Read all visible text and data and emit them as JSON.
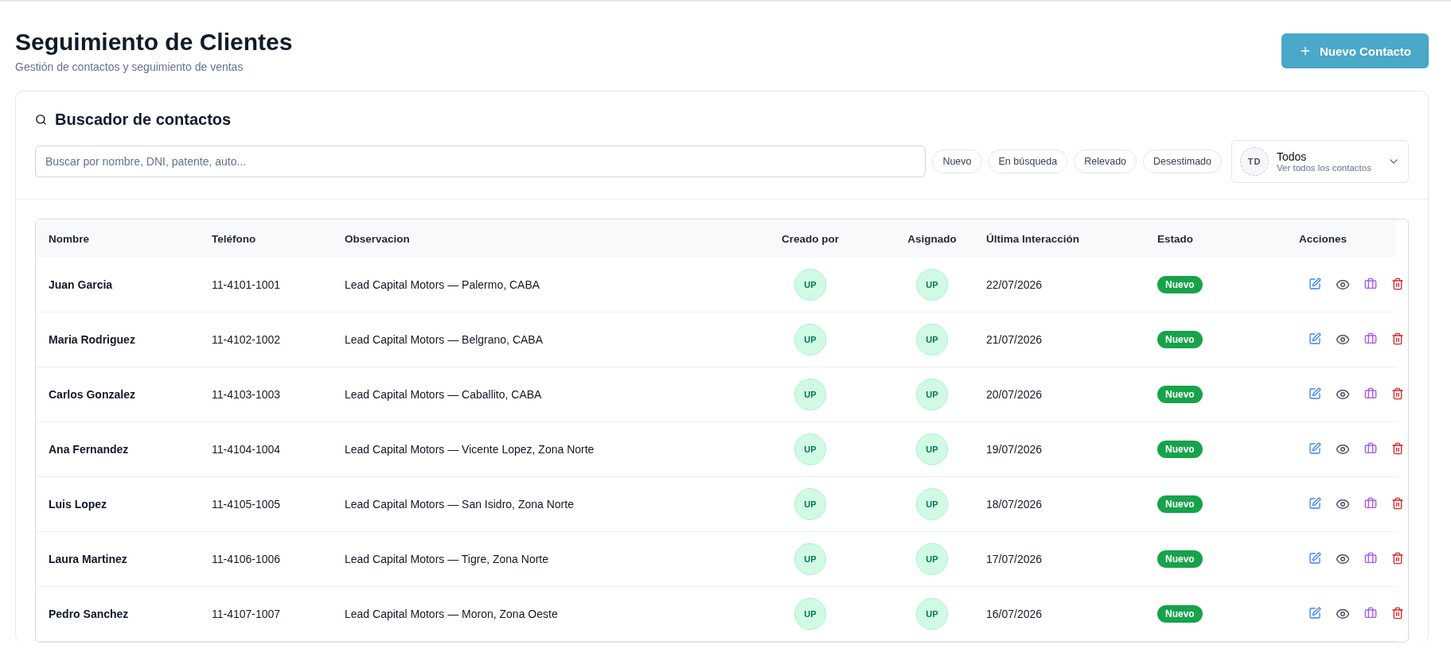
{
  "header": {
    "title": "Seguimiento de Clientes",
    "subtitle": "Gestión de contactos y seguimiento de ventas",
    "new_button": "Nuevo Contacto"
  },
  "search_panel": {
    "title": "Buscador de contactos",
    "search": {
      "placeholder": "Buscar por nombre, DNI, patente, auto..."
    },
    "filters": [
      {
        "label": "Nuevo",
        "selected": false
      },
      {
        "label": "En búsqueda",
        "selected": false
      },
      {
        "label": "Relevado",
        "selected": false
      },
      {
        "label": "Desestimado",
        "selected": false
      }
    ],
    "user_select": {
      "initials": "TD",
      "title": "Todos",
      "subtitle": "Ver todos los contactos"
    }
  },
  "table": {
    "columns": [
      "Nombre",
      "Teléfono",
      "Observacion",
      "Creado por",
      "Asignado",
      "Última Interacción",
      "Estado",
      "Acciones"
    ],
    "rows": [
      {
        "name": "Juan Garcia",
        "phone": "11-4101-1001",
        "note": "Lead Capital Motors — Palermo, CABA",
        "created_by": "UP",
        "assigned": "UP",
        "last": "22/07/2026",
        "status": "Nuevo"
      },
      {
        "name": "Maria Rodriguez",
        "phone": "11-4102-1002",
        "note": "Lead Capital Motors — Belgrano, CABA",
        "created_by": "UP",
        "assigned": "UP",
        "last": "21/07/2026",
        "status": "Nuevo"
      },
      {
        "name": "Carlos Gonzalez",
        "phone": "11-4103-1003",
        "note": "Lead Capital Motors — Caballito, CABA",
        "created_by": "UP",
        "assigned": "UP",
        "last": "20/07/2026",
        "status": "Nuevo"
      },
      {
        "name": "Ana Fernandez",
        "phone": "11-4104-1004",
        "note": "Lead Capital Motors — Vicente Lopez, Zona Norte",
        "created_by": "UP",
        "assigned": "UP",
        "last": "19/07/2026",
        "status": "Nuevo"
      },
      {
        "name": "Luis Lopez",
        "phone": "11-4105-1005",
        "note": "Lead Capital Motors — San Isidro, Zona Norte",
        "created_by": "UP",
        "assigned": "UP",
        "last": "18/07/2026",
        "status": "Nuevo"
      },
      {
        "name": "Laura Martinez",
        "phone": "11-4106-1006",
        "note": "Lead Capital Motors — Tigre, Zona Norte",
        "created_by": "UP",
        "assigned": "UP",
        "last": "17/07/2026",
        "status": "Nuevo"
      },
      {
        "name": "Pedro Sanchez",
        "phone": "11-4107-1007",
        "note": "Lead Capital Motors — Moron, Zona Oeste",
        "created_by": "UP",
        "assigned": "UP",
        "last": "16/07/2026",
        "status": "Nuevo"
      }
    ]
  }
}
